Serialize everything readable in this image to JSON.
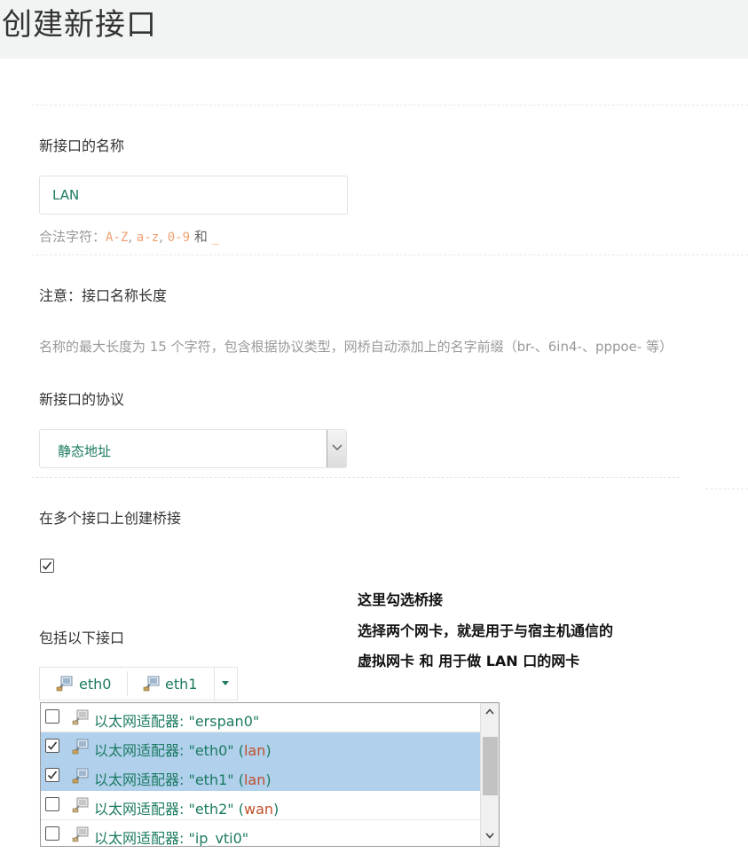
{
  "page": {
    "title": "创建新接口"
  },
  "name_field": {
    "label": "新接口的名称",
    "value": "LAN",
    "hint_prefix": "合法字符：",
    "hint_az_upper": "A-Z",
    "hint_az_lower": "a-z",
    "hint_digits": "0-9",
    "hint_and": "和",
    "hint_underscore": "_",
    "comma": ","
  },
  "notice": {
    "label": "注意：接口名称长度",
    "text": "名称的最大长度为 15 个字符，包含根据协议类型，网桥自动添加上的名字前缀（br-、6in4-、pppoe- 等）"
  },
  "protocol": {
    "label": "新接口的协议",
    "selected": "静态地址"
  },
  "bridge": {
    "label": "在多个接口上创建桥接",
    "checked": true
  },
  "annotation": {
    "line1": "这里勾选桥接",
    "line2": "选择两个网卡，就是用于与宿主机通信的",
    "line3": "虚拟网卡 和 用于做 LAN 口的网卡"
  },
  "include": {
    "label": "包括以下接口",
    "chips": [
      "eth0",
      "eth1"
    ],
    "options": [
      {
        "text": "以太网适配器: \"erspan0\"",
        "zone": "",
        "checked": false
      },
      {
        "text": "以太网适配器: \"eth0\"",
        "zone": "lan",
        "checked": true
      },
      {
        "text": "以太网适配器: \"eth1\"",
        "zone": "lan",
        "checked": true
      },
      {
        "text": "以太网适配器: \"eth2\"",
        "zone": "wan",
        "checked": false
      },
      {
        "text": "以太网适配器: \"ip_vti0\"",
        "zone": "",
        "checked": false
      }
    ]
  },
  "colors": {
    "value_green": "#1b7a61",
    "zone_red": "#c0502b",
    "selected_row": "#b0d0ec",
    "hint_code": "#f0a070"
  },
  "icons": {
    "nic": "ethernet-adapter-icon",
    "check": "checkmark-icon",
    "dropdown": "chevron-down-icon"
  }
}
